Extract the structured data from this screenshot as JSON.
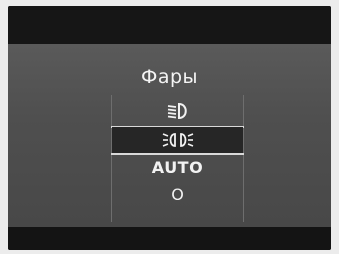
{
  "title": "Фары",
  "menu": {
    "items": [
      {
        "id": "low-beam",
        "icon": "low-beam-headlight-icon",
        "label": ""
      },
      {
        "id": "parking",
        "icon": "parking-lights-icon",
        "label": "",
        "selected": true
      },
      {
        "id": "auto",
        "icon": "",
        "label": "AUTO"
      },
      {
        "id": "off",
        "icon": "",
        "label": "O"
      }
    ]
  },
  "colors": {
    "background": "#4f4f4f",
    "bars": "#161616",
    "text": "#f2f2f2",
    "selection": "#262626",
    "divider": "#d9d9d9"
  }
}
